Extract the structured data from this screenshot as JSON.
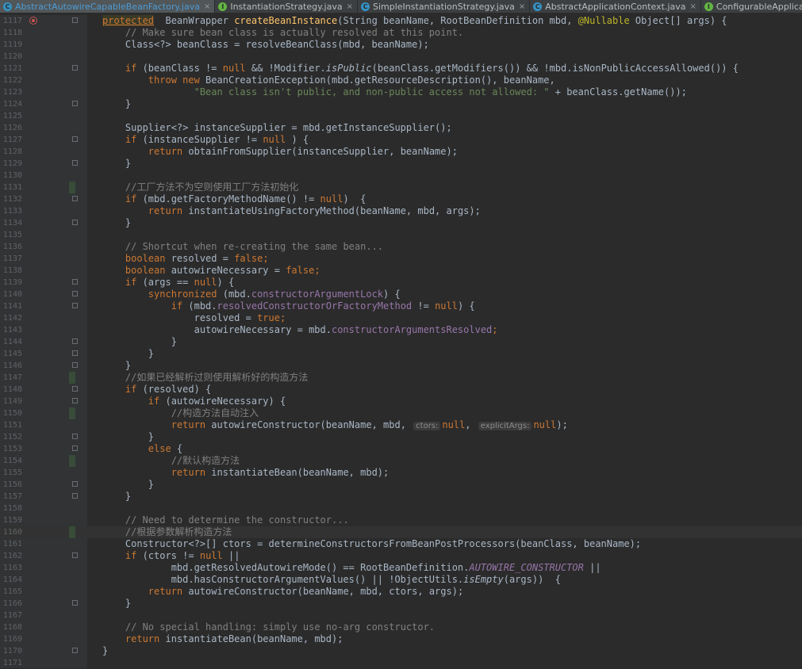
{
  "tabs": [
    {
      "label": "AbstractAutowireCapableBeanFactory.java",
      "kind": "C",
      "active": true
    },
    {
      "label": "InstantiationStrategy.java",
      "kind": "I",
      "active": false
    },
    {
      "label": "SimpleInstantiationStrategy.java",
      "kind": "C",
      "active": false
    },
    {
      "label": "AbstractApplicationContext.java",
      "kind": "C",
      "active": false
    },
    {
      "label": "ConfigurableApplicationContext.java",
      "kind": "I",
      "active": false
    }
  ],
  "tab_close_glyph": "×",
  "colors": {
    "keyword": "#cc7832",
    "comment": "#808080",
    "string": "#6a8759",
    "method": "#ffc66d",
    "field": "#9876aa",
    "annotation": "#bbb529",
    "text": "#a9b7c6",
    "background": "#2b2b2b"
  },
  "editor": {
    "current_line": 1160,
    "lines": [
      {
        "n": "1117",
        "tokens": [
          [
            "kw-hl",
            "protected"
          ],
          [
            "",
            "  BeanWrapper "
          ],
          [
            "fn",
            "createBeanInstance"
          ],
          [
            "",
            "(String beanName, RootBeanDefinition mbd, "
          ],
          [
            "ann",
            "@Nullable"
          ],
          [
            "",
            " Object[] args) {"
          ]
        ]
      },
      {
        "n": "1118",
        "tokens": [
          [
            "",
            "    "
          ],
          [
            "cm",
            "// Make sure bean class is actually resolved at this point."
          ]
        ]
      },
      {
        "n": "1119",
        "tokens": [
          [
            "",
            "    Class<?> beanClass = resolveBeanClass(mbd, beanName);"
          ]
        ]
      },
      {
        "n": "1120",
        "tokens": []
      },
      {
        "n": "1121",
        "tokens": [
          [
            "",
            "    "
          ],
          [
            "kw",
            "if"
          ],
          [
            "",
            " (beanClass != "
          ],
          [
            "kw",
            "null"
          ],
          [
            "",
            " && !Modifier."
          ],
          [
            "ital",
            "isPublic"
          ],
          [
            "",
            "(beanClass.getModifiers()) && !mbd.isNonPublicAccessAllowed()) {"
          ]
        ]
      },
      {
        "n": "1122",
        "tokens": [
          [
            "",
            "        "
          ],
          [
            "kw",
            "throw new"
          ],
          [
            "",
            " BeanCreationException(mbd.getResourceDescription(), beanName,"
          ]
        ]
      },
      {
        "n": "1123",
        "tokens": [
          [
            "",
            "                "
          ],
          [
            "str",
            "\"Bean class isn't public, and non-public access not allowed: \""
          ],
          [
            "",
            " + beanClass.getName());"
          ]
        ]
      },
      {
        "n": "1124",
        "tokens": [
          [
            "",
            "    }"
          ]
        ]
      },
      {
        "n": "1125",
        "tokens": []
      },
      {
        "n": "1126",
        "tokens": [
          [
            "",
            "    Supplier<?> instanceSupplier = mbd.getInstanceSupplier();"
          ]
        ]
      },
      {
        "n": "1127",
        "tokens": [
          [
            "",
            "    "
          ],
          [
            "kw",
            "if"
          ],
          [
            "",
            " (instanceSupplier != "
          ],
          [
            "kw",
            "null"
          ],
          [
            "",
            " ) {"
          ]
        ]
      },
      {
        "n": "1128",
        "tokens": [
          [
            "",
            "        "
          ],
          [
            "kw",
            "return"
          ],
          [
            "",
            " obtainFromSupplier(instanceSupplier, beanName);"
          ]
        ]
      },
      {
        "n": "1129",
        "tokens": [
          [
            "",
            "    }"
          ]
        ]
      },
      {
        "n": "1130",
        "tokens": []
      },
      {
        "n": "1131",
        "tokens": [
          [
            "",
            "    "
          ],
          [
            "cm",
            "//工厂方法不为空则使用工厂方法初始化"
          ]
        ]
      },
      {
        "n": "1132",
        "tokens": [
          [
            "",
            "    "
          ],
          [
            "kw",
            "if"
          ],
          [
            "",
            " (mbd.getFactoryMethodName() != "
          ],
          [
            "kw",
            "null"
          ],
          [
            "",
            ")  {"
          ]
        ]
      },
      {
        "n": "1133",
        "tokens": [
          [
            "",
            "        "
          ],
          [
            "kw",
            "return"
          ],
          [
            "",
            " instantiateUsingFactoryMethod(beanName, mbd, args);"
          ]
        ]
      },
      {
        "n": "1134",
        "tokens": [
          [
            "",
            "    }"
          ]
        ]
      },
      {
        "n": "1135",
        "tokens": []
      },
      {
        "n": "1136",
        "tokens": [
          [
            "",
            "    "
          ],
          [
            "cm",
            "// Shortcut when re-creating the same bean..."
          ]
        ]
      },
      {
        "n": "1137",
        "tokens": [
          [
            "",
            "    "
          ],
          [
            "kw",
            "boolean"
          ],
          [
            "",
            " resolved = "
          ],
          [
            "kw",
            "false"
          ],
          [
            "kw",
            ";"
          ]
        ]
      },
      {
        "n": "1138",
        "tokens": [
          [
            "",
            "    "
          ],
          [
            "kw",
            "boolean"
          ],
          [
            "",
            " autowireNecessary = "
          ],
          [
            "kw",
            "false"
          ],
          [
            "kw",
            ";"
          ]
        ]
      },
      {
        "n": "1139",
        "tokens": [
          [
            "",
            "    "
          ],
          [
            "kw",
            "if"
          ],
          [
            "",
            " (args == "
          ],
          [
            "kw",
            "null"
          ],
          [
            "",
            ") {"
          ]
        ]
      },
      {
        "n": "1140",
        "tokens": [
          [
            "",
            "        "
          ],
          [
            "kw",
            "synchronized"
          ],
          [
            "",
            " (mbd."
          ],
          [
            "fld",
            "constructorArgumentLock"
          ],
          [
            "",
            ") {"
          ]
        ]
      },
      {
        "n": "1141",
        "tokens": [
          [
            "",
            "            "
          ],
          [
            "kw",
            "if"
          ],
          [
            "",
            " (mbd."
          ],
          [
            "fld",
            "resolvedConstructorOrFactoryMethod"
          ],
          [
            "",
            " != "
          ],
          [
            "kw",
            "null"
          ],
          [
            "",
            ") {"
          ]
        ]
      },
      {
        "n": "1142",
        "tokens": [
          [
            "",
            "                resolved = "
          ],
          [
            "kw",
            "true"
          ],
          [
            "kw",
            ";"
          ]
        ]
      },
      {
        "n": "1143",
        "tokens": [
          [
            "",
            "                autowireNecessary = mbd."
          ],
          [
            "fld",
            "constructorArgumentsResolved"
          ],
          [
            "kw",
            ";"
          ]
        ]
      },
      {
        "n": "1144",
        "tokens": [
          [
            "",
            "            }"
          ]
        ]
      },
      {
        "n": "1145",
        "tokens": [
          [
            "",
            "        }"
          ]
        ]
      },
      {
        "n": "1146",
        "tokens": [
          [
            "",
            "    }"
          ]
        ]
      },
      {
        "n": "1147",
        "tokens": [
          [
            "",
            "    "
          ],
          [
            "cm",
            "//如果已经解析过则使用解析好的构造方法"
          ]
        ]
      },
      {
        "n": "1148",
        "tokens": [
          [
            "",
            "    "
          ],
          [
            "kw",
            "if"
          ],
          [
            "",
            " (resolved) {"
          ]
        ]
      },
      {
        "n": "1149",
        "tokens": [
          [
            "",
            "        "
          ],
          [
            "kw",
            "if"
          ],
          [
            "",
            " (autowireNecessary) {"
          ]
        ]
      },
      {
        "n": "1150",
        "tokens": [
          [
            "",
            "            "
          ],
          [
            "cm",
            "//构造方法自动注入"
          ]
        ]
      },
      {
        "n": "1151",
        "tokens": [
          [
            "",
            "            "
          ],
          [
            "kw",
            "return"
          ],
          [
            "",
            " autowireConstructor(beanName, mbd, "
          ],
          [
            "hint",
            "ctors:"
          ],
          [
            "kw",
            "null"
          ],
          [
            "",
            ", "
          ],
          [
            "hint",
            "explicitArgs:"
          ],
          [
            "kw",
            "null"
          ],
          [
            "",
            ");"
          ]
        ]
      },
      {
        "n": "1152",
        "tokens": [
          [
            "",
            "        }"
          ]
        ]
      },
      {
        "n": "1153",
        "tokens": [
          [
            "",
            "        "
          ],
          [
            "kw",
            "else"
          ],
          [
            "",
            " {"
          ]
        ]
      },
      {
        "n": "1154",
        "tokens": [
          [
            "",
            "            "
          ],
          [
            "cm",
            "//默认构造方法"
          ]
        ]
      },
      {
        "n": "1155",
        "tokens": [
          [
            "",
            "            "
          ],
          [
            "kw",
            "return"
          ],
          [
            "",
            " instantiateBean(beanName, mbd);"
          ]
        ]
      },
      {
        "n": "1156",
        "tokens": [
          [
            "",
            "        }"
          ]
        ]
      },
      {
        "n": "1157",
        "tokens": [
          [
            "",
            "    }"
          ]
        ]
      },
      {
        "n": "1158",
        "tokens": []
      },
      {
        "n": "1159",
        "tokens": [
          [
            "",
            "    "
          ],
          [
            "cm",
            "// Need to determine the constructor..."
          ]
        ]
      },
      {
        "n": "1160",
        "tokens": [
          [
            "",
            "    "
          ],
          [
            "cm",
            "//根据参数解析构造方法"
          ]
        ]
      },
      {
        "n": "1161",
        "tokens": [
          [
            "",
            "    Constructor<?>[] ctors = determineConstructorsFromBeanPostProcessors(beanClass, beanName);"
          ]
        ]
      },
      {
        "n": "1162",
        "tokens": [
          [
            "",
            "    "
          ],
          [
            "kw",
            "if"
          ],
          [
            "",
            " (ctors != "
          ],
          [
            "kw",
            "null"
          ],
          [
            "",
            " ||"
          ]
        ]
      },
      {
        "n": "1163",
        "tokens": [
          [
            "",
            "            mbd.getResolvedAutowireMode() == RootBeanDefinition."
          ],
          [
            "stat",
            "AUTOWIRE_CONSTRUCTOR"
          ],
          [
            "",
            " ||"
          ]
        ]
      },
      {
        "n": "1164",
        "tokens": [
          [
            "",
            "            mbd.hasConstructorArgumentValues() || !ObjectUtils."
          ],
          [
            "ital",
            "isEmpty"
          ],
          [
            "",
            "(args))  {"
          ]
        ]
      },
      {
        "n": "1165",
        "tokens": [
          [
            "",
            "        "
          ],
          [
            "kw",
            "return"
          ],
          [
            "",
            " autowireConstructor(beanName, mbd, ctors, args);"
          ]
        ]
      },
      {
        "n": "1166",
        "tokens": [
          [
            "",
            "    }"
          ]
        ]
      },
      {
        "n": "1167",
        "tokens": []
      },
      {
        "n": "1168",
        "tokens": [
          [
            "",
            "    "
          ],
          [
            "cm",
            "// No special handling: simply use no-arg constructor."
          ]
        ]
      },
      {
        "n": "1169",
        "tokens": [
          [
            "",
            "    "
          ],
          [
            "kw",
            "return"
          ],
          [
            "",
            " instantiateBean(beanName, mbd);"
          ]
        ]
      },
      {
        "n": "1170",
        "tokens": [
          [
            "",
            "}"
          ]
        ]
      },
      {
        "n": "1171",
        "tokens": []
      }
    ]
  }
}
